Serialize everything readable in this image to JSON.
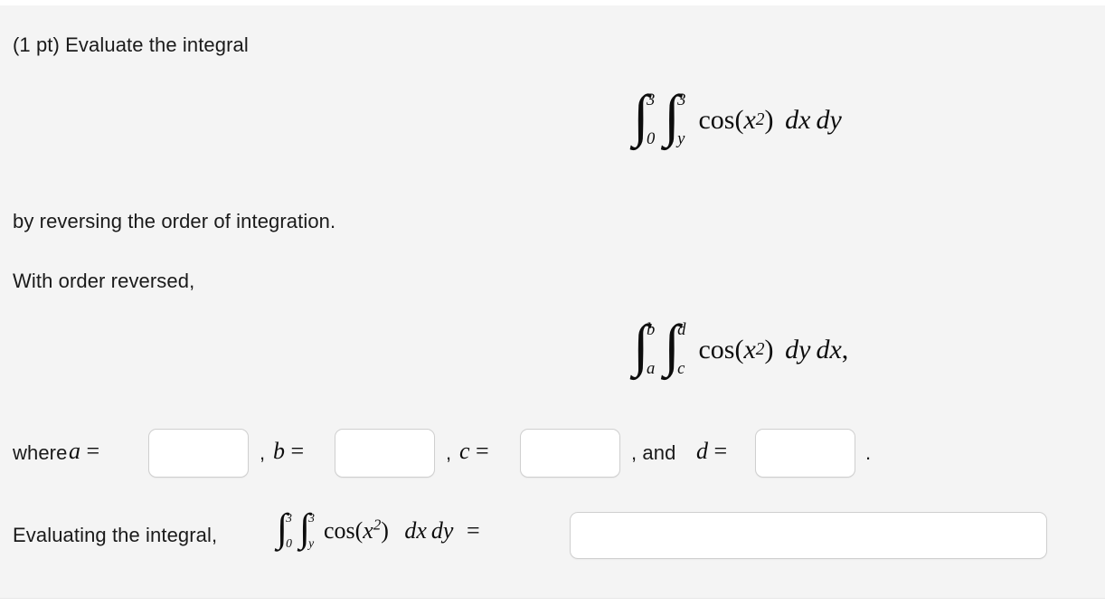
{
  "problem": {
    "points_label": "(1 pt) Evaluate the integral",
    "instruction": "by reversing the order of integration.",
    "reversed_intro": "With order reversed,",
    "where_label": "where",
    "and_label": ", and",
    "comma": ",",
    "period": ".",
    "equals": "=",
    "evaluating_label": "Evaluating the integral,"
  },
  "integral_original": {
    "outer_lower": "0",
    "outer_upper": "3",
    "inner_lower": "y",
    "inner_upper": "3",
    "integrand_function": "cos",
    "integrand_variable": "x",
    "integrand_exponent": "2",
    "differential_inner": "dx",
    "differential_outer": "dy",
    "trailing": ""
  },
  "integral_reversed": {
    "outer_lower": "a",
    "outer_upper": "b",
    "inner_lower": "c",
    "inner_upper": "d",
    "integrand_function": "cos",
    "integrand_variable": "x",
    "integrand_exponent": "2",
    "differential_inner": "dy",
    "differential_outer": "dx",
    "trailing": ","
  },
  "integral_inline": {
    "outer_lower": "0",
    "outer_upper": "3",
    "inner_lower": "y",
    "inner_upper": "3",
    "integrand_function": "cos",
    "integrand_variable": "x",
    "integrand_exponent": "2",
    "differential_inner": "dx",
    "differential_outer": "dy"
  },
  "fields": {
    "a": {
      "symbol": "a",
      "value": "",
      "placeholder": ""
    },
    "b": {
      "symbol": "b",
      "value": "",
      "placeholder": ""
    },
    "c": {
      "symbol": "c",
      "value": "",
      "placeholder": ""
    },
    "d": {
      "symbol": "d",
      "value": "",
      "placeholder": ""
    },
    "result": {
      "value": "",
      "placeholder": ""
    }
  },
  "colors": {
    "background": "#f4f4f4",
    "text": "#1a1a1a",
    "field_border": "#cfcfcf",
    "field_background": "#ffffff"
  }
}
